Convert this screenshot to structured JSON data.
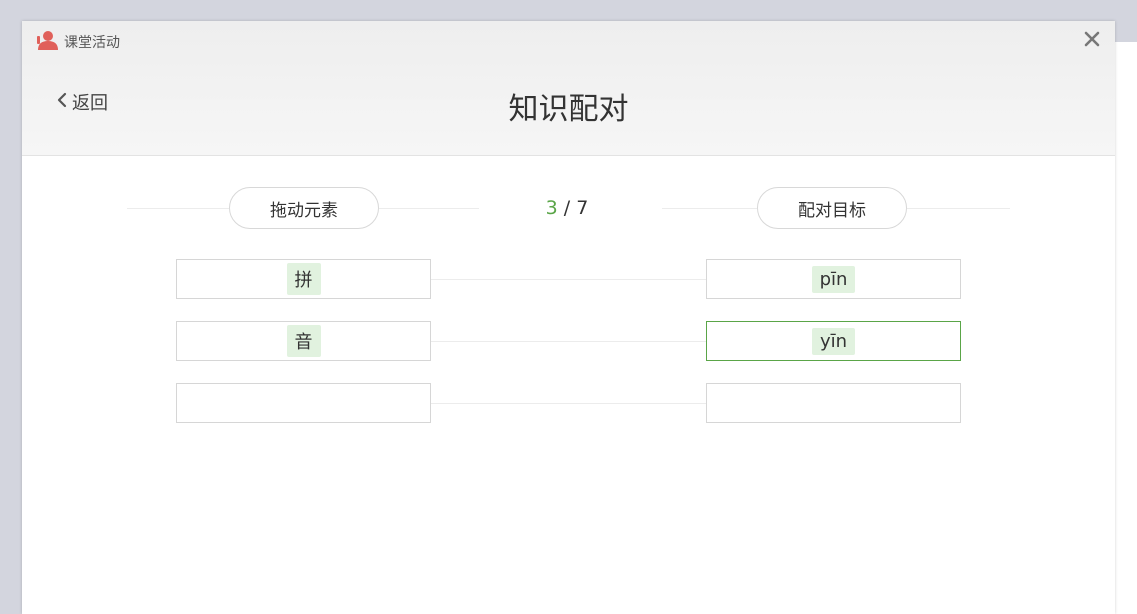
{
  "window": {
    "app_title": "课堂活动",
    "page_title": "知识配对",
    "back_label": "返回"
  },
  "columns": {
    "left_label": "拖动元素",
    "right_label": "配对目标"
  },
  "progress": {
    "current": "3",
    "separator": " / ",
    "total": "7"
  },
  "pairs": [
    {
      "left": "拼",
      "right": "pīn",
      "active": false
    },
    {
      "left": "音",
      "right": "yīn",
      "active": true
    },
    {
      "left": "",
      "right": "",
      "active": false
    }
  ],
  "colors": {
    "accent": "#5aa548",
    "tile_bg": "#e1f2df",
    "icon": "#e0605a"
  },
  "icons": {
    "app": "user-icon",
    "close": "close-icon",
    "back": "chevron-left-icon"
  }
}
